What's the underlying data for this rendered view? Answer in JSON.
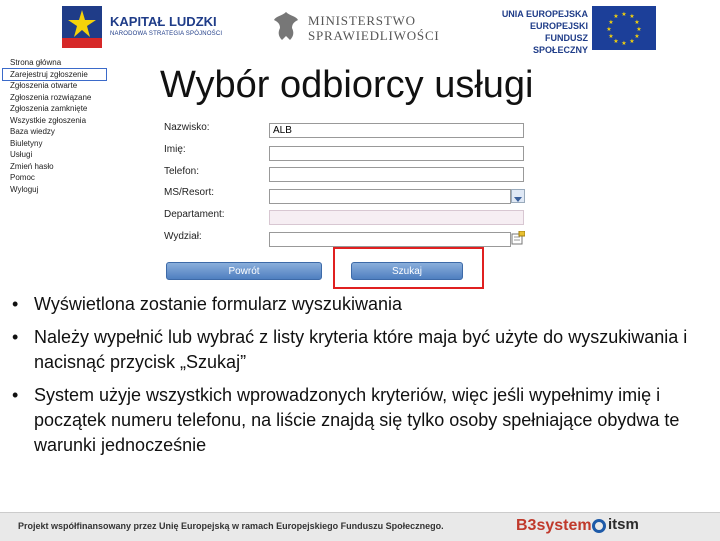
{
  "banner": {
    "kapital_title": "KAPITAŁ LUDZKI",
    "kapital_sub": "NARODOWA STRATEGIA SPÓJNOŚCI",
    "ministry_line1": "MINISTERSTWO",
    "ministry_line2": "SPRAWIEDLIWOŚCI",
    "eu_line1": "UNIA EUROPEJSKA",
    "eu_line2": "EUROPEJSKI",
    "eu_line3": "FUNDUSZ SPOŁECZNY",
    "eu_flag_color": "#1c3f99",
    "eu_star_color": "#f5d20a"
  },
  "sidebar": {
    "items": [
      {
        "label": "Strona główna",
        "active": false
      },
      {
        "label": "Zarejestruj zgłoszenie",
        "active": true
      },
      {
        "label": "Zgłoszenia otwarte",
        "active": false
      },
      {
        "label": "Zgłoszenia rozwiązane",
        "active": false
      },
      {
        "label": "Zgłoszenia zamknięte",
        "active": false
      },
      {
        "label": "Wszystkie zgłoszenia",
        "active": false
      },
      {
        "label": "Baza wiedzy",
        "active": false
      },
      {
        "label": "Biuletyny",
        "active": false
      },
      {
        "label": "Usługi",
        "active": false
      },
      {
        "label": "Zmień hasło",
        "active": false
      },
      {
        "label": "Pomoc",
        "active": false
      },
      {
        "label": "Wyloguj",
        "active": false
      }
    ]
  },
  "page": {
    "title": "Wybór odbiorcy usługi"
  },
  "form": {
    "surname_label": "Nazwisko:",
    "surname_value": "ALB",
    "name_label": "Imię:",
    "name_value": "",
    "phone_label": "Telefon:",
    "phone_value": "",
    "ministry_label": "MS/Resort:",
    "ministry_value": "",
    "department_label": "Departament:",
    "department_value": "",
    "division_label": "Wydział:",
    "division_value": ""
  },
  "buttons": {
    "back_label": "Powrót",
    "search_label": "Szukaj"
  },
  "highlight_color": "#e02020",
  "bullets": [
    "Wyświetlona zostanie formularz wyszukiwania",
    "Należy wypełnić lub wybrać z listy kryteria które maja być użyte do wyszukiwania i nacisnąć przycisk „Szukaj”",
    "System użyje wszystkich wprowadzonych kryteriów, więc jeśli wypełnimy imię i początek numeru telefonu, na liście znajdą się tylko osoby spełniające obydwa te warunki jednocześnie"
  ],
  "bullet_glyph": "•",
  "footer": {
    "text": "Projekt współfinansowany przez Unię Europejską w ramach Europejskiego Funduszu Społecznego.",
    "b3": "B3system",
    "itsm": "itsm"
  }
}
